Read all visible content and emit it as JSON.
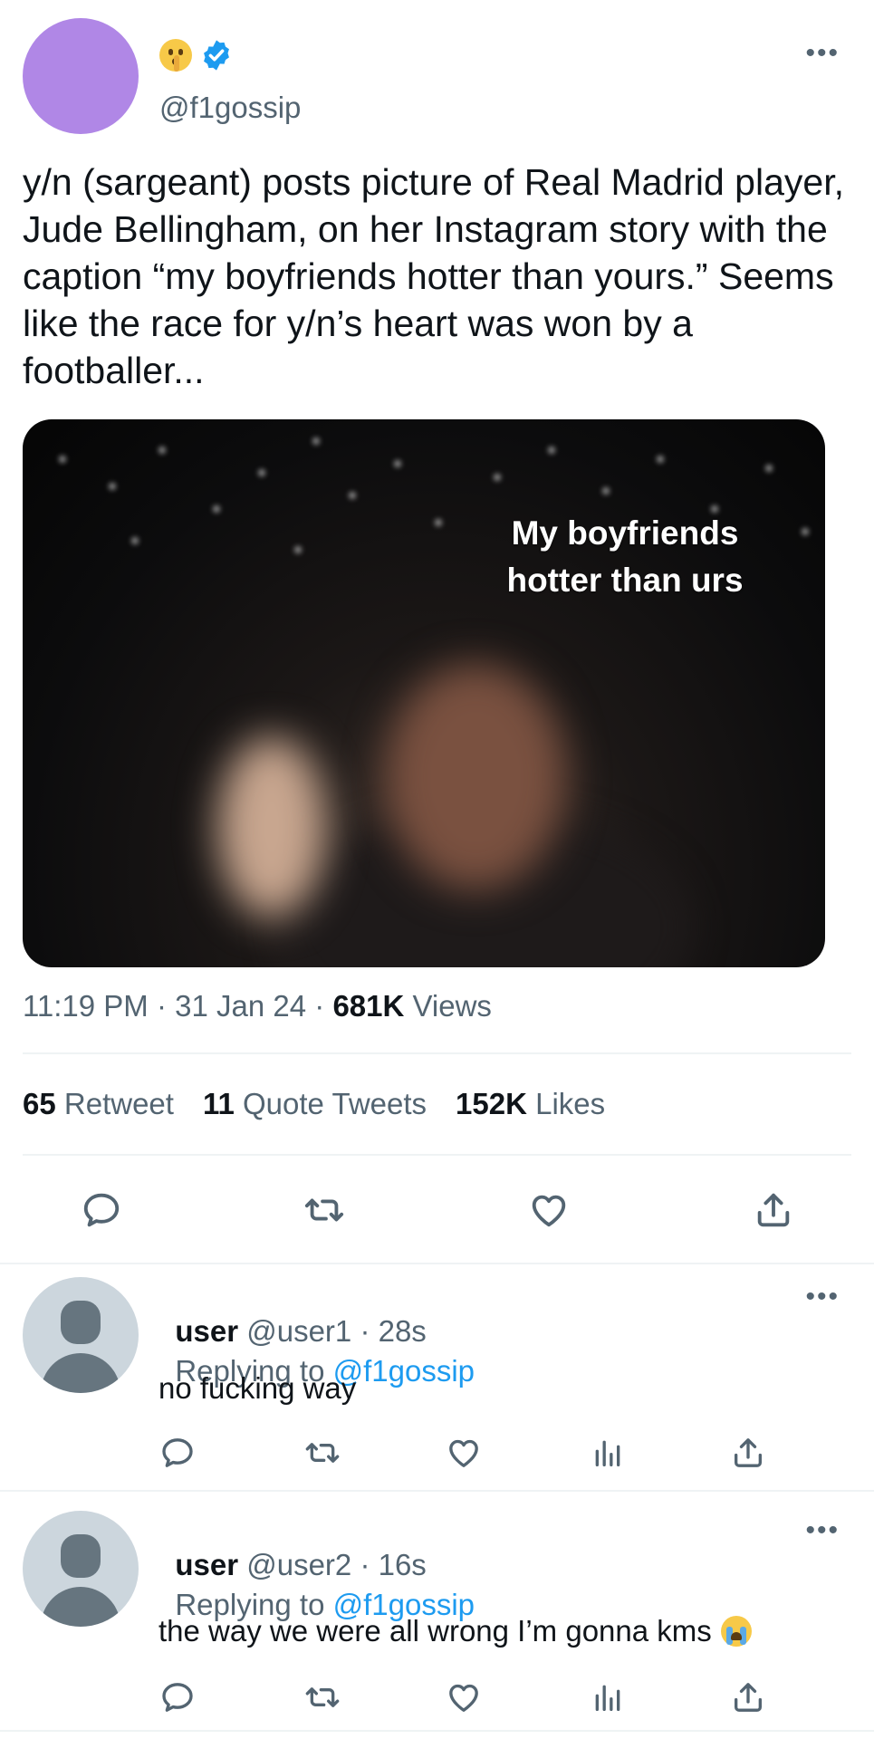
{
  "tweet": {
    "handle": "@f1gossip",
    "text": "y/n (sargeant) posts picture of Real Madrid player, Jude Bellingham, on her Instagram story with the caption “my boyfriends hotter than yours.” Seems like the race for y/n’s heart was won by a footballer...",
    "media_caption_line1": "My boyfriends",
    "media_caption_line2": "hotter than urs",
    "time": "11:19 PM",
    "sep": " · ",
    "date": "31 Jan 24",
    "views_count": "681K",
    "views_label": " Views",
    "more": "•••",
    "stats": {
      "retweets_count": "65",
      "retweets_label": " Retweet",
      "quotes_count": "11",
      "quotes_label": " Quote Tweets",
      "likes_count": "152K",
      "likes_label": " Likes"
    },
    "icons": [
      "comment-icon",
      "retweet-icon",
      "like-icon",
      "share-icon"
    ],
    "avatar_color": "#b087e6",
    "accent_color": "#1d9bf0"
  },
  "replies": [
    {
      "name": "user",
      "handle_time": " @user1 · 28s",
      "replying_label": "Replying to ",
      "replying_to": "@f1gossip",
      "text": "no fucking way",
      "more": "•••"
    },
    {
      "name": "user",
      "handle_time": " @user2 · 16s",
      "replying_label": "Replying to ",
      "replying_to": "@f1gossip",
      "text": "the way we were all wrong I’m gonna kms",
      "more": "•••"
    }
  ]
}
